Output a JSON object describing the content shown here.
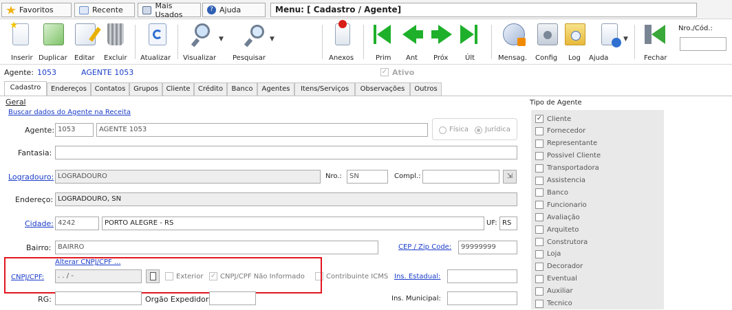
{
  "topbar": {
    "tabs": [
      {
        "label": "Favoritos",
        "icon": "star-icon"
      },
      {
        "label": "Recente",
        "icon": "clock-icon"
      },
      {
        "label": "Mais Usados",
        "icon": "monitor-icon"
      },
      {
        "label": "Ajuda",
        "icon": "help-icon"
      }
    ],
    "menu_title": "Menu: [ Cadastro / Agente]"
  },
  "toolbar": {
    "buttons": [
      "Inserir",
      "Duplicar",
      "Editar",
      "Excluir",
      "Atualizar",
      "Visualizar",
      "Pesquisar",
      "Anexos",
      "Prim",
      "Ant",
      "Próx",
      "Últ",
      "Mensag.",
      "Config",
      "Log",
      "Ajuda",
      "Fechar"
    ],
    "nro_label": "Nro./Cód.:",
    "nro_value": ""
  },
  "agent_header": {
    "label": "Agente:",
    "code": "1053",
    "name": "AGENTE 1053",
    "ativo_label": "Ativo",
    "ativo_checked": true
  },
  "tabs": [
    "Cadastro",
    "Endereços",
    "Contatos",
    "Grupos",
    "Cliente",
    "Crédito",
    "Banco",
    "Agentes",
    "Itens/Serviços",
    "Observações",
    "Outros"
  ],
  "active_tab": "Cadastro",
  "form": {
    "group_title": "Geral",
    "buscar_link": "Buscar dados do Agente na Receita",
    "agente_label": "Agente:",
    "agente_code": "1053",
    "agente_name": "AGENTE 1053",
    "fisica_label": "Física",
    "juridica_label": "Jurídica",
    "fantasia_label": "Fantasia:",
    "fantasia_value": "",
    "logradouro_label": "Logradouro:",
    "logradouro_value": "LOGRADOURO",
    "nro_label": "Nro.:",
    "nro_value": "SN",
    "compl_label": "Compl.:",
    "compl_value": "",
    "endereco_label": "Endereço:",
    "endereco_value": "LOGRADOURO, SN",
    "cidade_label": "Cidade:",
    "cidade_code": "4242",
    "cidade_name": "PORTO ALEGRE - RS",
    "uf_label": "UF:",
    "uf_value": "RS",
    "bairro_label": "Bairro:",
    "bairro_value": "BAIRRO",
    "cep_label": "CEP / Zip Code:",
    "cep_value": "99999999",
    "alterar_link": "Alterar CNPJ/CPF ...",
    "cnpj_label": "CNPJ/CPF:",
    "cnpj_value": ". . / -",
    "exterior_label": "Exterior",
    "nao_informado_label": "CNPJ/CPF Não Informado",
    "contribuinte_label": "Contribuinte ICMS",
    "ins_estadual_label": "Ins. Estadual:",
    "ins_estadual_value": "",
    "rg_label": "RG:",
    "rg_value": "",
    "orgao_label": "Orgão Expedidor:",
    "orgao_value": "",
    "ins_municipal_label": "Ins. Municipal:",
    "ins_municipal_value": ""
  },
  "tipo_agente": {
    "title": "Tipo de Agente",
    "items": [
      {
        "label": "Cliente",
        "checked": true
      },
      {
        "label": "Fornecedor",
        "checked": false
      },
      {
        "label": "Representante",
        "checked": false
      },
      {
        "label": "Possivel Cliente",
        "checked": false
      },
      {
        "label": "Transportadora",
        "checked": false
      },
      {
        "label": "Assistencia",
        "checked": false
      },
      {
        "label": "Banco",
        "checked": false
      },
      {
        "label": "Funcionario",
        "checked": false
      },
      {
        "label": "Avaliação",
        "checked": false
      },
      {
        "label": "Arquiteto",
        "checked": false
      },
      {
        "label": "Construtora",
        "checked": false
      },
      {
        "label": "Loja",
        "checked": false
      },
      {
        "label": "Decorador",
        "checked": false
      },
      {
        "label": "Eventual",
        "checked": false
      },
      {
        "label": "Auxiliar",
        "checked": false
      },
      {
        "label": "Tecnico",
        "checked": false
      }
    ]
  },
  "colors": {
    "link": "#1a3cc8",
    "highlight_box": "#e1141e",
    "nav_arrow": "#1fb02b"
  }
}
